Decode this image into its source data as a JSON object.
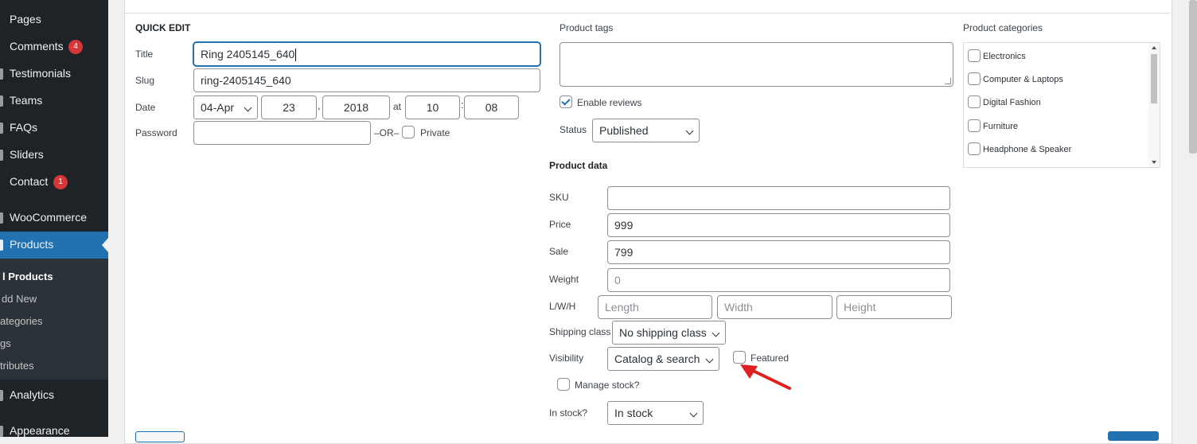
{
  "sidebar": {
    "items": [
      {
        "label": "Pages"
      },
      {
        "label": "Comments",
        "badge": "4"
      },
      {
        "label": "Testimonials"
      },
      {
        "label": "Teams"
      },
      {
        "label": "FAQs"
      },
      {
        "label": "Sliders"
      },
      {
        "label": "Contact",
        "badge": "1"
      },
      {
        "label": "WooCommerce"
      },
      {
        "label": "Products"
      },
      {
        "label": "Analytics"
      },
      {
        "label": "Appearance"
      }
    ],
    "submenu": [
      "l Products",
      "dd New",
      "ategories",
      "gs",
      "tributes"
    ]
  },
  "quick_edit": {
    "heading": "QUICK EDIT",
    "title_label": "Title",
    "title_value": "Ring 2405145_640",
    "slug_label": "Slug",
    "slug_value": "ring-2405145_640",
    "date_label": "Date",
    "month_value": "04-Apr",
    "day_value": "23",
    "year_value": "2018",
    "at_label": "at",
    "hour_value": "10",
    "minute_value": "08",
    "comma": ",",
    "colon": ":",
    "password_label": "Password",
    "or_label": "–OR–",
    "private_label": "Private"
  },
  "tags": {
    "label": "Product tags",
    "enable_reviews_label": "Enable reviews",
    "enable_reviews_checked": true,
    "status_label": "Status",
    "status_value": "Published"
  },
  "categories": {
    "label": "Product categories",
    "items": [
      "Electronics",
      "Computer & Laptops",
      "Digital Fashion",
      "Furniture",
      "Headphone & Speaker"
    ]
  },
  "product_data": {
    "heading": "Product data",
    "sku_label": "SKU",
    "sku_value": "",
    "price_label": "Price",
    "price_value": "999",
    "sale_label": "Sale",
    "sale_value": "799",
    "weight_label": "Weight",
    "weight_placeholder": "0",
    "lwh_label": "L/W/H",
    "length_placeholder": "Length",
    "width_placeholder": "Width",
    "height_placeholder": "Height",
    "shipping_label": "Shipping class",
    "shipping_value": "No shipping class",
    "visibility_label": "Visibility",
    "visibility_value": "Catalog & search",
    "featured_label": "Featured",
    "manage_stock_label": "Manage stock?",
    "in_stock_label": "In stock?",
    "in_stock_value": "In stock"
  },
  "colors": {
    "sidebar_bg": "#1d2327",
    "active": "#2271b1",
    "badge": "#d63638",
    "annotation_arrow": "#e02020"
  }
}
